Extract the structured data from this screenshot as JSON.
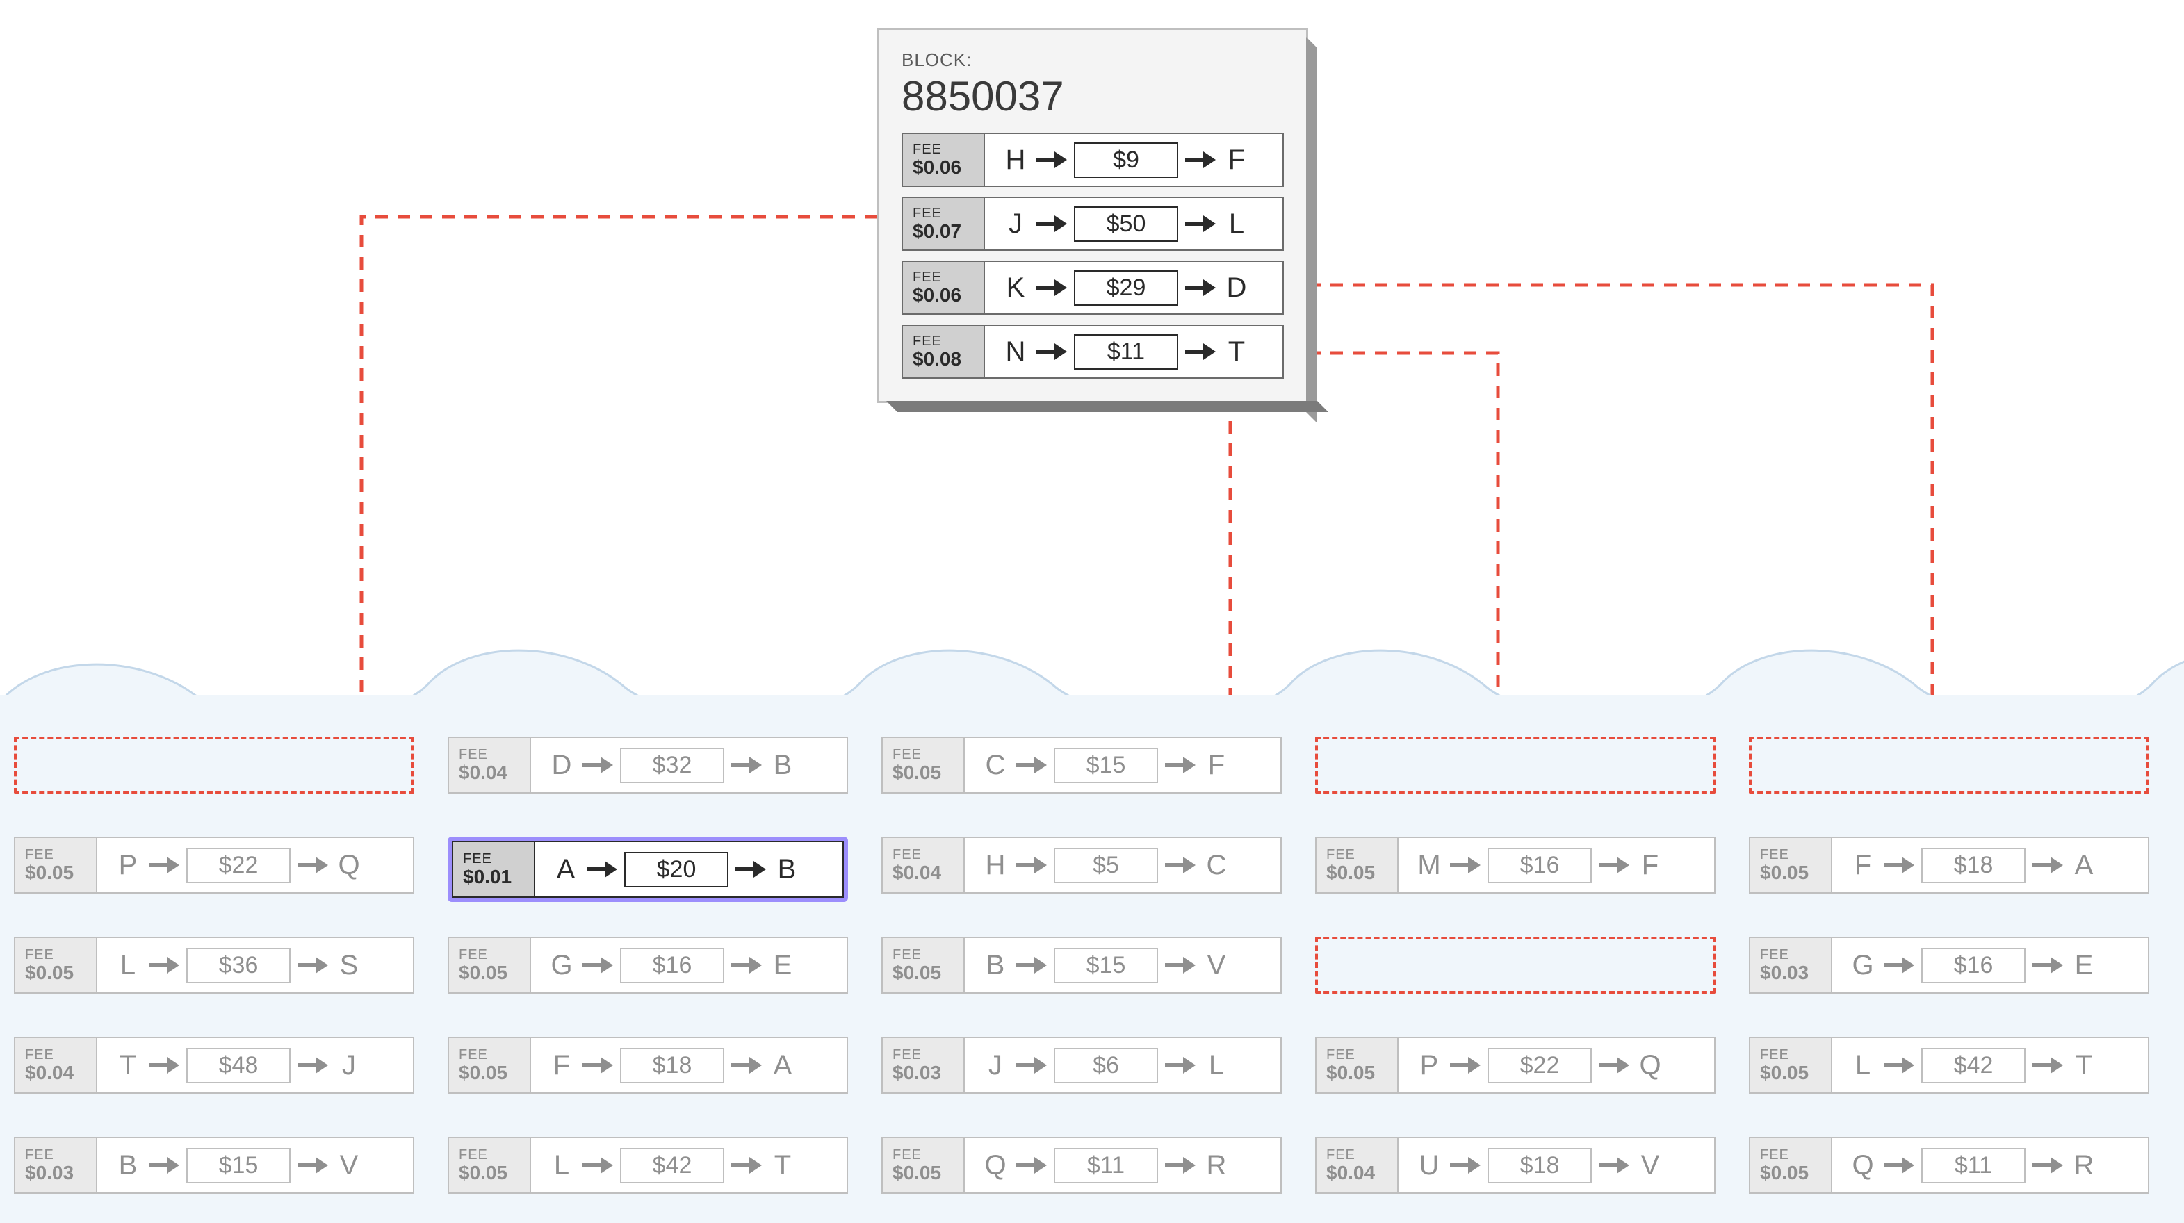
{
  "block": {
    "label": "BLOCK:",
    "number": "8850037",
    "txs": [
      {
        "fee_label": "FEE",
        "fee": "$0.06",
        "from": "H",
        "amount": "$9",
        "to": "F"
      },
      {
        "fee_label": "FEE",
        "fee": "$0.07",
        "from": "J",
        "amount": "$50",
        "to": "L"
      },
      {
        "fee_label": "FEE",
        "fee": "$0.06",
        "from": "K",
        "amount": "$29",
        "to": "D"
      },
      {
        "fee_label": "FEE",
        "fee": "$0.08",
        "from": "N",
        "amount": "$11",
        "to": "T"
      }
    ]
  },
  "pool_columns": [
    [
      {
        "type": "ghost"
      },
      {
        "type": "tx",
        "fee_label": "FEE",
        "fee": "$0.05",
        "from": "P",
        "amount": "$22",
        "to": "Q"
      },
      {
        "type": "tx",
        "fee_label": "FEE",
        "fee": "$0.05",
        "from": "L",
        "amount": "$36",
        "to": "S"
      },
      {
        "type": "tx",
        "fee_label": "FEE",
        "fee": "$0.04",
        "from": "T",
        "amount": "$48",
        "to": "J"
      },
      {
        "type": "tx",
        "fee_label": "FEE",
        "fee": "$0.03",
        "from": "B",
        "amount": "$15",
        "to": "V"
      }
    ],
    [
      {
        "type": "tx",
        "fee_label": "FEE",
        "fee": "$0.04",
        "from": "D",
        "amount": "$32",
        "to": "B"
      },
      {
        "type": "highlight",
        "fee_label": "FEE",
        "fee": "$0.01",
        "from": "A",
        "amount": "$20",
        "to": "B"
      },
      {
        "type": "tx",
        "fee_label": "FEE",
        "fee": "$0.05",
        "from": "G",
        "amount": "$16",
        "to": "E"
      },
      {
        "type": "tx",
        "fee_label": "FEE",
        "fee": "$0.05",
        "from": "F",
        "amount": "$18",
        "to": "A"
      },
      {
        "type": "tx",
        "fee_label": "FEE",
        "fee": "$0.05",
        "from": "L",
        "amount": "$42",
        "to": "T"
      }
    ],
    [
      {
        "type": "tx",
        "fee_label": "FEE",
        "fee": "$0.05",
        "from": "C",
        "amount": "$15",
        "to": "F"
      },
      {
        "type": "tx",
        "fee_label": "FEE",
        "fee": "$0.04",
        "from": "H",
        "amount": "$5",
        "to": "C"
      },
      {
        "type": "tx",
        "fee_label": "FEE",
        "fee": "$0.05",
        "from": "B",
        "amount": "$15",
        "to": "V"
      },
      {
        "type": "tx",
        "fee_label": "FEE",
        "fee": "$0.03",
        "from": "J",
        "amount": "$6",
        "to": "L"
      },
      {
        "type": "tx",
        "fee_label": "FEE",
        "fee": "$0.05",
        "from": "Q",
        "amount": "$11",
        "to": "R"
      }
    ],
    [
      {
        "type": "ghost"
      },
      {
        "type": "tx",
        "fee_label": "FEE",
        "fee": "$0.05",
        "from": "M",
        "amount": "$16",
        "to": "F"
      },
      {
        "type": "ghost"
      },
      {
        "type": "tx",
        "fee_label": "FEE",
        "fee": "$0.05",
        "from": "P",
        "amount": "$22",
        "to": "Q"
      },
      {
        "type": "tx",
        "fee_label": "FEE",
        "fee": "$0.04",
        "from": "U",
        "amount": "$18",
        "to": "V"
      }
    ],
    [
      {
        "type": "ghost"
      },
      {
        "type": "tx",
        "fee_label": "FEE",
        "fee": "$0.05",
        "from": "F",
        "amount": "$18",
        "to": "A"
      },
      {
        "type": "tx",
        "fee_label": "FEE",
        "fee": "$0.03",
        "from": "G",
        "amount": "$16",
        "to": "E"
      },
      {
        "type": "tx",
        "fee_label": "FEE",
        "fee": "$0.05",
        "from": "L",
        "amount": "$42",
        "to": "T"
      },
      {
        "type": "tx",
        "fee_label": "FEE",
        "fee": "$0.05",
        "from": "Q",
        "amount": "$11",
        "to": "R"
      }
    ]
  ],
  "colors": {
    "connector": "#e74c3c",
    "highlight": "#9c8efc",
    "pool_bg": "#f0f6fb",
    "wave": "#c3d7e9"
  }
}
